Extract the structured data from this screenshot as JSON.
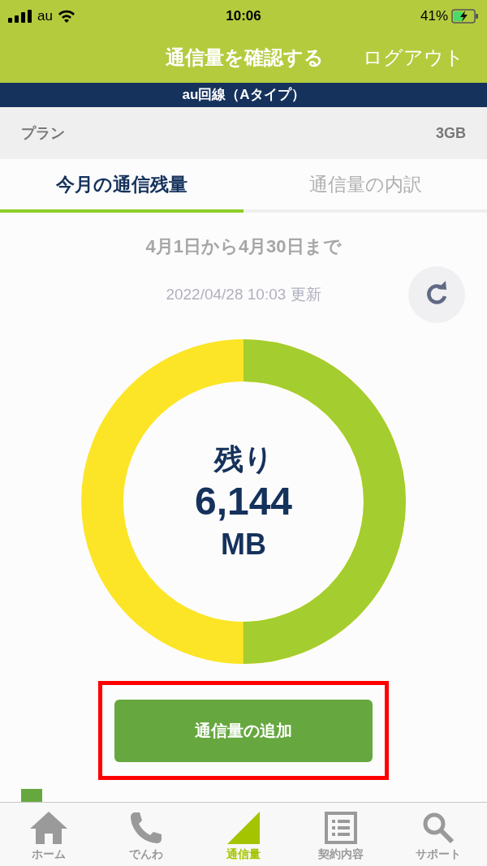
{
  "status_bar": {
    "carrier": "au",
    "time": "10:06",
    "battery": "41%"
  },
  "header": {
    "title": "通信量を確認する",
    "logout": "ログアウト"
  },
  "line_banner": "au回線（Aタイプ）",
  "plan": {
    "label": "プラン",
    "value": "3GB"
  },
  "tabs": [
    {
      "label": "今月の通信残量",
      "selected": true
    },
    {
      "label": "通信量の内訳",
      "selected": false
    }
  ],
  "period": "4月1日から4月30日まで",
  "updated": "2022/04/28 10:03 更新",
  "gauge": {
    "level": 0.5,
    "caption": "残り",
    "amount": "6,144",
    "unit": "MB"
  },
  "add_button": {
    "label": "通信量の追加",
    "highlighted": true
  },
  "legend": [
    {
      "color": "#66a83f"
    }
  ],
  "bottom_nav": [
    {
      "kind": "home",
      "label": "ホーム",
      "selected": false
    },
    {
      "kind": "phone",
      "label": "でんわ",
      "selected": false
    },
    {
      "kind": "data",
      "label": "通信量",
      "selected": true
    },
    {
      "kind": "contract",
      "label": "契約内容",
      "selected": false
    },
    {
      "kind": "support",
      "label": "サポート",
      "selected": false
    }
  ]
}
